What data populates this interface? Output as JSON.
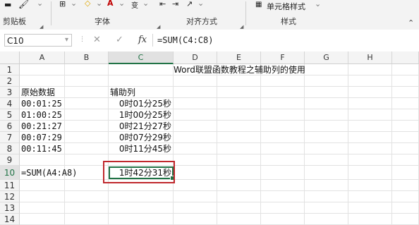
{
  "ribbon": {
    "groups": [
      {
        "label": "剪贴板"
      },
      {
        "label": "字体"
      },
      {
        "label": "对齐方式"
      },
      {
        "label": "样式"
      }
    ],
    "cell_styles_label": "单元格样式",
    "small_marks": [
      "A",
      "A",
      "变"
    ]
  },
  "formula_bar": {
    "name_box": "C10",
    "cancel_icon": "✕",
    "enter_icon": "✓",
    "fx_label": "fx",
    "formula": "=SUM(C4:C8)"
  },
  "columns": [
    "A",
    "B",
    "C",
    "D",
    "E",
    "F",
    "G",
    "H"
  ],
  "selected_column": "C",
  "rows": [
    "1",
    "2",
    "3",
    "4",
    "5",
    "6",
    "7",
    "8",
    "9",
    "10",
    "11",
    "12",
    "13",
    "14"
  ],
  "selected_row": "10",
  "cells": {
    "title": "Word联盟函数教程之辅助列的使用",
    "a3": "原始数据",
    "c3": "辅助列",
    "a4": "00:01:25",
    "c4": "0时01分25秒",
    "a5": "01:00:25",
    "c5": "1时00分25秒",
    "a6": "00:21:27",
    "c6": "0时21分27秒",
    "a7": "00:07:29",
    "c7": "0时07分29秒",
    "a8": "00:11:45",
    "c8": "0时11分45秒",
    "a10": "=SUM(A4:A8)",
    "c10": "1时42分31秒"
  },
  "colors": {
    "accent": "#217346",
    "highlight_border": "#c0282d"
  }
}
